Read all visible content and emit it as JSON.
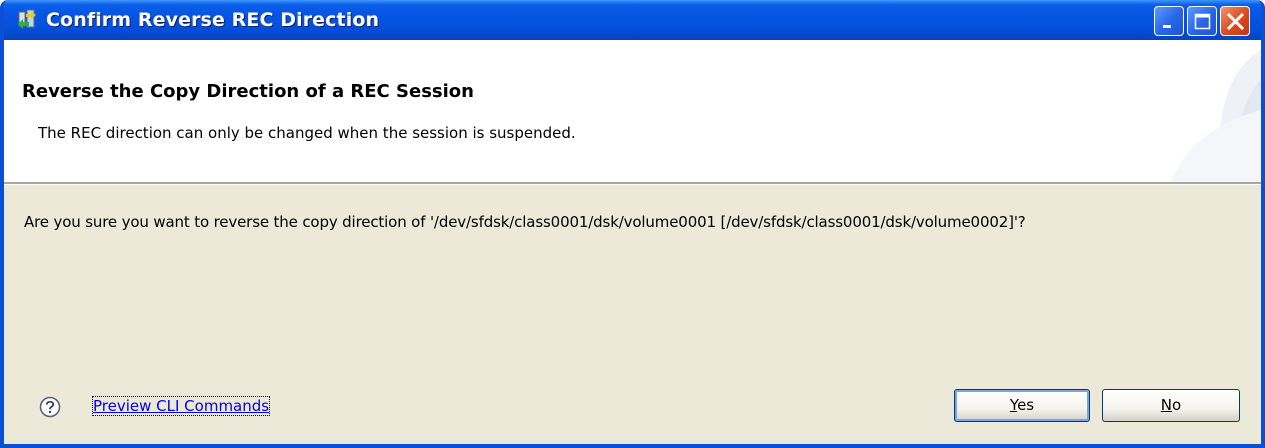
{
  "window": {
    "title": "Confirm Reverse REC Direction",
    "icons": {
      "title": "app-icon",
      "minimize": "minimize-icon",
      "maximize": "maximize-icon",
      "close": "close-icon"
    }
  },
  "header": {
    "title": "Reverse the Copy Direction of a REC Session",
    "description": "The REC direction can only be changed when the session is suspended."
  },
  "body": {
    "message": "Are you sure you want to reverse the copy direction of '/dev/sfdsk/class0001/dsk/volume0001 [/dev/sfdsk/class0001/dsk/volume0002]'?"
  },
  "footer": {
    "help_icon": "help-icon",
    "preview_link": "Preview CLI Commands",
    "yes_mnemonic": "Y",
    "yes_rest": "es",
    "no_mnemonic": "N",
    "no_rest": "o"
  },
  "colors": {
    "titlebar": "#0554e3",
    "dialog_background": "#ece9d8",
    "header_background": "#ffffff",
    "link": "#0000ee",
    "close_button": "#dc4a1f"
  }
}
